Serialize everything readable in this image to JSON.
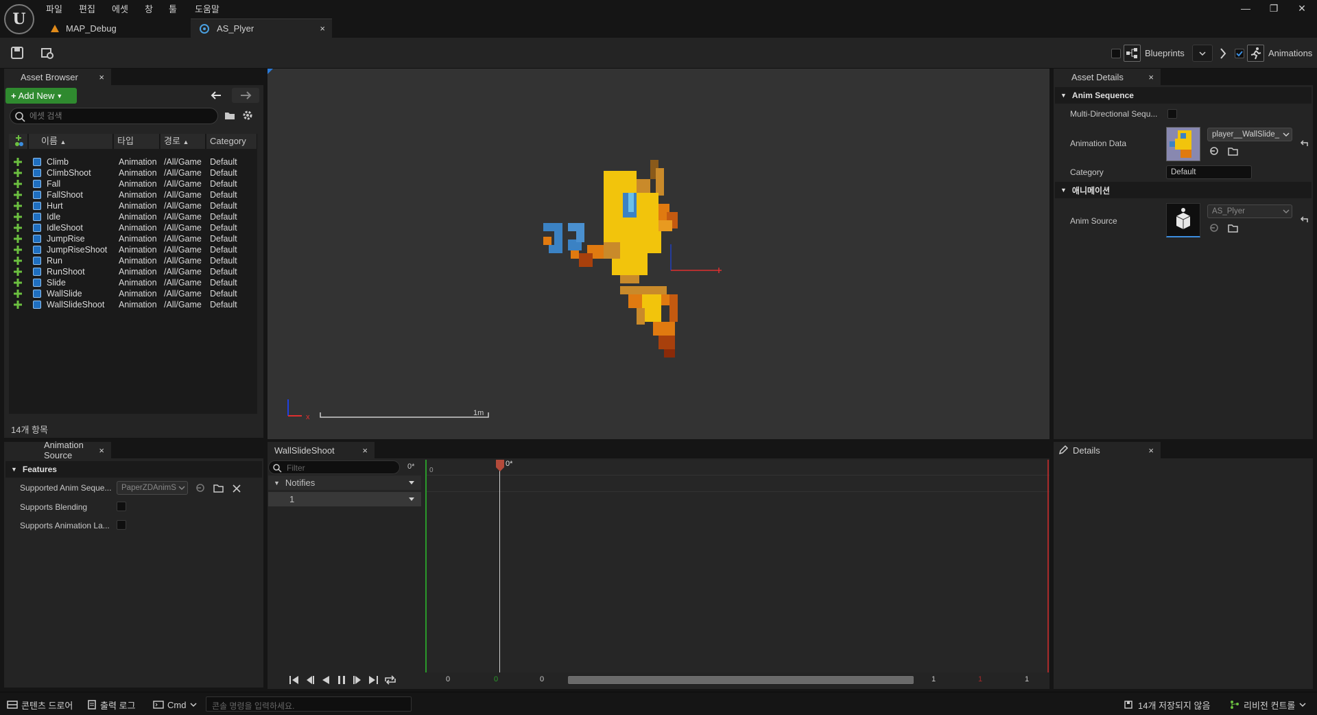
{
  "menu": [
    "파일",
    "편집",
    "에셋",
    "창",
    "툴",
    "도움말"
  ],
  "window_controls": {
    "minimize": "—",
    "restore": "❐",
    "close": "✕"
  },
  "doc_tabs": [
    {
      "label": "MAP_Debug"
    },
    {
      "label": "AS_Plyer",
      "close": "×"
    }
  ],
  "toolbar": {
    "blueprints_label": "Blueprints",
    "animations_label": "Animations"
  },
  "asset_browser": {
    "tab_label": "Asset Browser",
    "close": "×",
    "add_new": "Add New",
    "search_placeholder": "에셋 검색",
    "columns": [
      "이름",
      "타입",
      "경로",
      "Category"
    ],
    "rows": [
      {
        "name": "Climb",
        "type": "Animation",
        "path": "/All/Game",
        "category": "Default"
      },
      {
        "name": "ClimbShoot",
        "type": "Animation",
        "path": "/All/Game",
        "category": "Default"
      },
      {
        "name": "Fall",
        "type": "Animation",
        "path": "/All/Game",
        "category": "Default"
      },
      {
        "name": "FallShoot",
        "type": "Animation",
        "path": "/All/Game",
        "category": "Default"
      },
      {
        "name": "Hurt",
        "type": "Animation",
        "path": "/All/Game",
        "category": "Default"
      },
      {
        "name": "Idle",
        "type": "Animation",
        "path": "/All/Game",
        "category": "Default"
      },
      {
        "name": "IdleShoot",
        "type": "Animation",
        "path": "/All/Game",
        "category": "Default"
      },
      {
        "name": "JumpRise",
        "type": "Animation",
        "path": "/All/Game",
        "category": "Default"
      },
      {
        "name": "JumpRiseShoot",
        "type": "Animation",
        "path": "/All/Game",
        "category": "Default"
      },
      {
        "name": "Run",
        "type": "Animation",
        "path": "/All/Game",
        "category": "Default"
      },
      {
        "name": "RunShoot",
        "type": "Animation",
        "path": "/All/Game",
        "category": "Default"
      },
      {
        "name": "Slide",
        "type": "Animation",
        "path": "/All/Game",
        "category": "Default"
      },
      {
        "name": "WallSlide",
        "type": "Animation",
        "path": "/All/Game",
        "category": "Default"
      },
      {
        "name": "WallSlideShoot",
        "type": "Animation",
        "path": "/All/Game",
        "category": "Default"
      }
    ],
    "item_count": "14개 항목"
  },
  "viewport": {
    "scale_label": "1m",
    "axis_x": "x"
  },
  "asset_details": {
    "tab_label": "Asset Details",
    "close": "×",
    "section_anim_sequence": "Anim Sequence",
    "multi_directional_label": "Multi-Directional Sequ...",
    "animation_data_label": "Animation Data",
    "animation_data_value": "player__WallSlide_",
    "category_label": "Category",
    "category_value": "Default",
    "section_animation": "애니메이션",
    "anim_source_label": "Anim Source",
    "anim_source_value": "AS_Plyer"
  },
  "animation_source": {
    "tab_label": "Animation Source",
    "close": "×",
    "section_features": "Features",
    "supported_label": "Supported Anim Seque...",
    "supported_value": "PaperZDAnimS",
    "blending_label": "Supports Blending",
    "layers_label": "Supports Animation La..."
  },
  "timeline": {
    "tab_label": "WallSlideShoot",
    "close": "×",
    "filter_placeholder": "Filter",
    "frame_current": "0*",
    "playhead_label": "0*",
    "ruler_start": "0",
    "notifies_label": "Notifies",
    "track_label": "1",
    "bottom": {
      "left_a": "0",
      "left_b": "0",
      "left_c": "0",
      "right_a": "1",
      "right_b": "1",
      "right_c": "1"
    }
  },
  "details_panel": {
    "tab_label": "Details",
    "close": "×"
  },
  "statusbar": {
    "content_drawer": "콘텐츠 드로어",
    "output_log": "출력 로그",
    "cmd": "Cmd",
    "console_placeholder": "콘솔 명령을 입력하세요.",
    "unsaved": "14개 저장되지 않음",
    "revision_control": "리비전 컨트롤"
  },
  "colors": {
    "accent_green": "#2f8a2f",
    "selection_blue": "#1f6fc0",
    "playhead": "#b34a3a",
    "sprite_yellow": "#f2c40c",
    "sprite_orange": "#e07a10"
  }
}
